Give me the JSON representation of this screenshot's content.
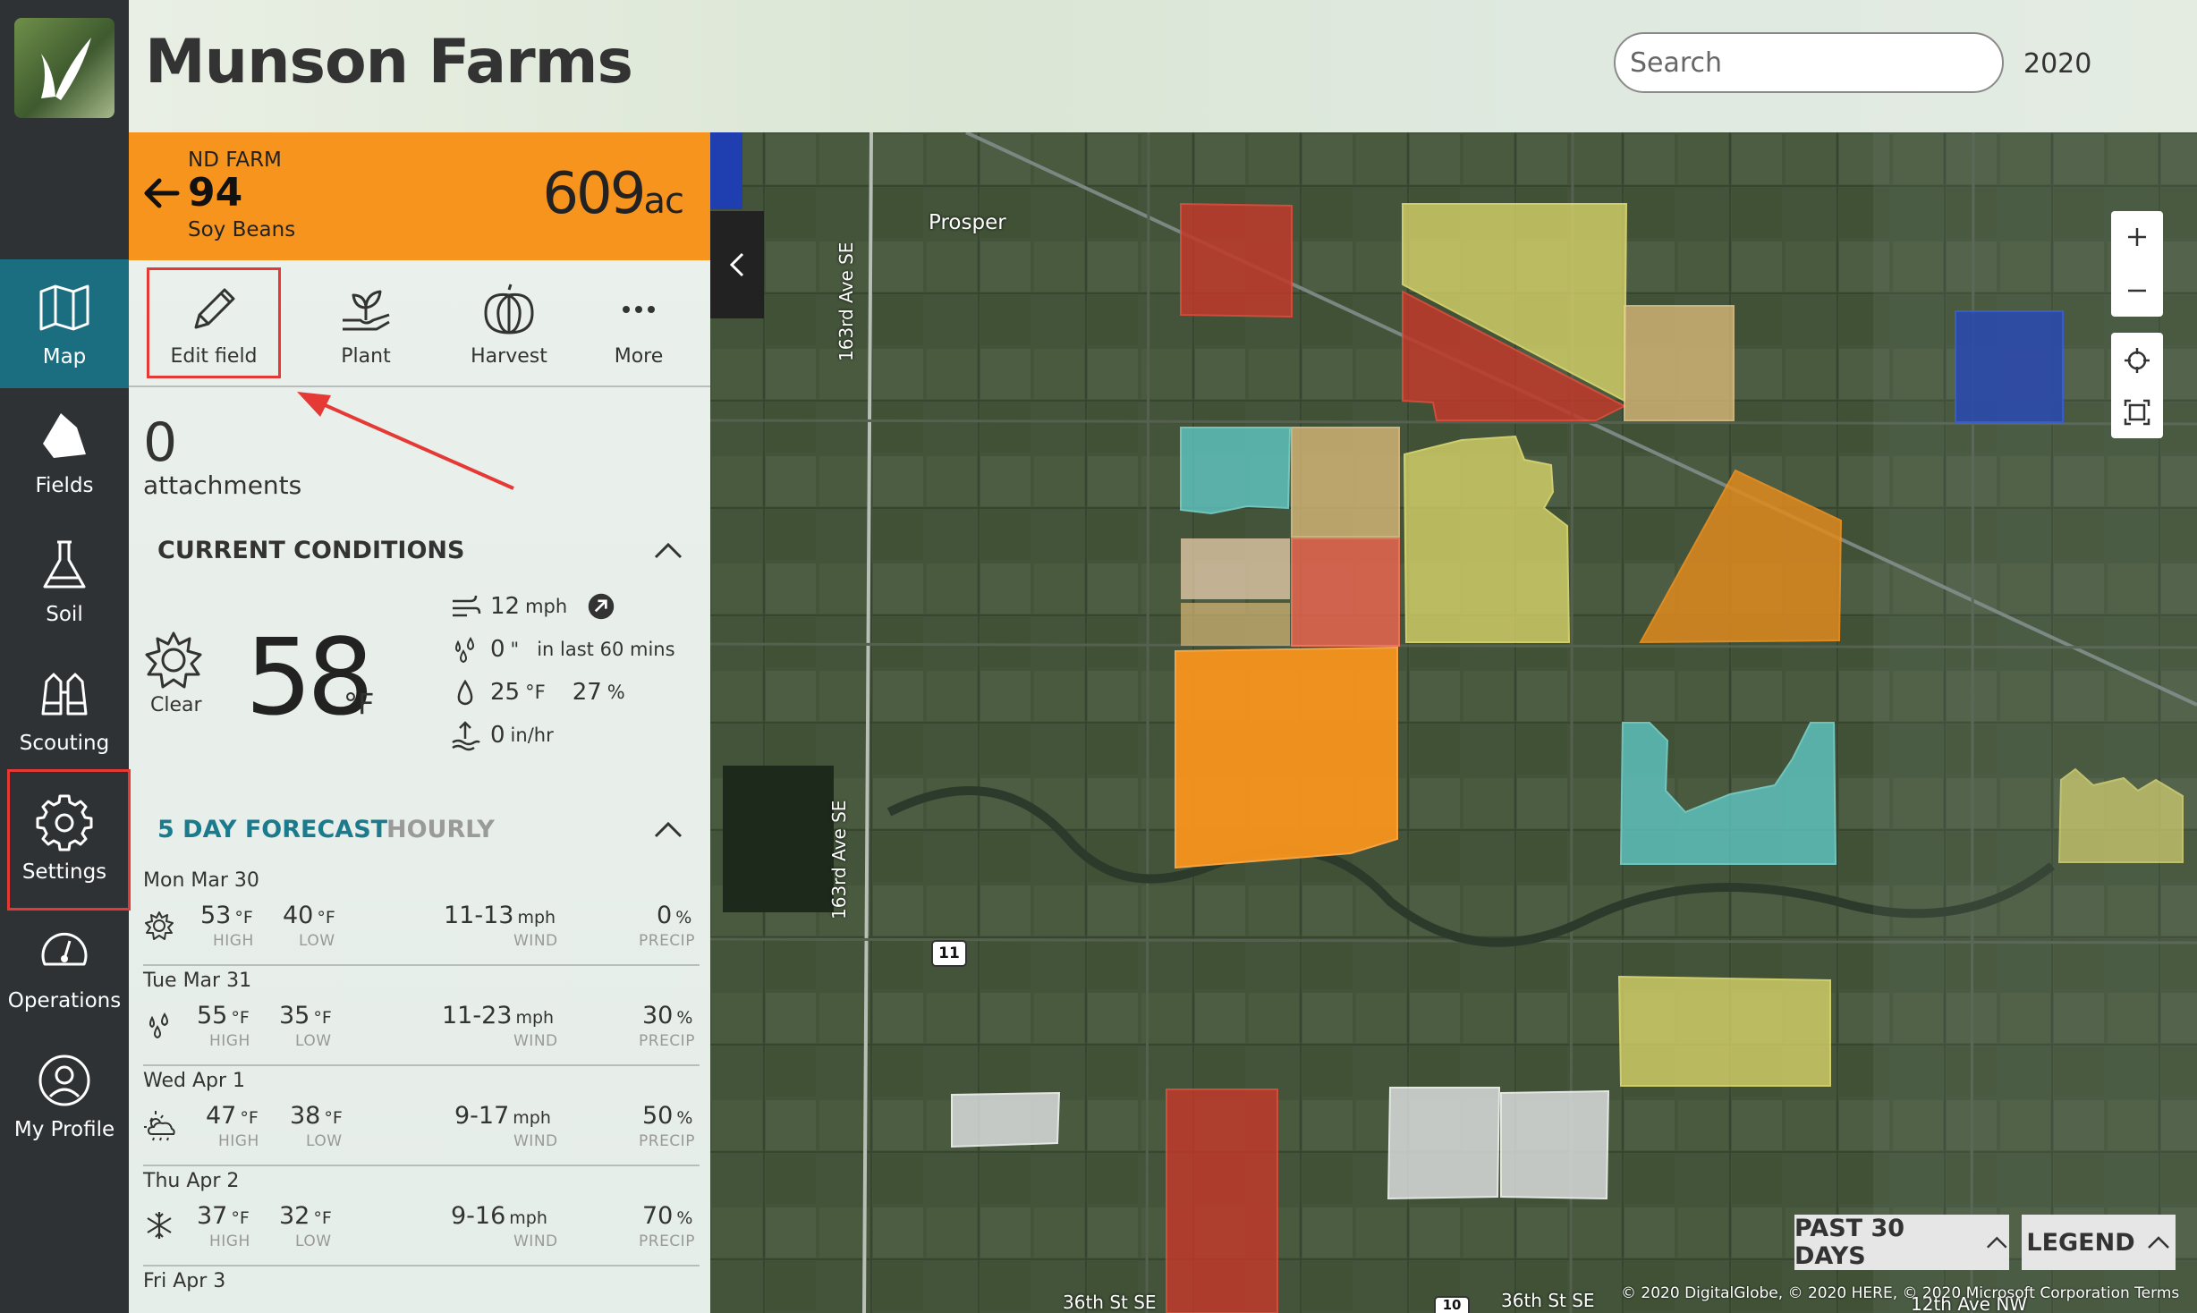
{
  "header": {
    "title": "Munson Farms",
    "search_placeholder": "Search",
    "year": "2020",
    "user_icon": "smiley-icon"
  },
  "nav": {
    "items": [
      {
        "label": "Map",
        "icon": "map-icon",
        "active": true
      },
      {
        "label": "Fields",
        "icon": "fields-icon"
      },
      {
        "label": "Soil",
        "icon": "flask-icon"
      },
      {
        "label": "Scouting",
        "icon": "binoculars-icon"
      },
      {
        "label": "Settings",
        "icon": "gear-icon"
      },
      {
        "label": "Operations",
        "icon": "gauge-icon"
      },
      {
        "label": "My Profile",
        "icon": "user-icon"
      }
    ]
  },
  "field": {
    "farm": "ND FARM",
    "name": "94",
    "crop": "Soy Beans",
    "acres": "609",
    "acres_unit": "ac"
  },
  "actions": [
    {
      "label": "Edit field",
      "icon": "pencil-icon"
    },
    {
      "label": "Plant",
      "icon": "sprout-icon"
    },
    {
      "label": "Harvest",
      "icon": "pumpkin-icon"
    },
    {
      "label": "More",
      "icon": "ellipsis-icon"
    }
  ],
  "attachments": {
    "count": "0",
    "label": "attachments"
  },
  "conditions": {
    "title": "CURRENT CONDITIONS",
    "sky": "Clear",
    "temp": "58",
    "temp_unit": "°F",
    "wind_value": "12",
    "wind_unit": "mph",
    "rain_value": "0",
    "rain_unit": "\"",
    "rain_note": "in last 60 mins",
    "dew_value": "25",
    "dew_unit": "°F",
    "humidity_value": "27",
    "humidity_unit": "%",
    "evap_value": "0",
    "evap_unit": "in/hr"
  },
  "forecast": {
    "title": "5 DAY FORECAST",
    "hourly_tab": "HOURLY",
    "labels": {
      "high": "HIGH",
      "low": "LOW",
      "wind": "WIND",
      "precip": "PRECIP"
    },
    "temp_unit": "°F",
    "wind_unit": "mph",
    "precip_unit": "%",
    "days": [
      {
        "date": "Mon Mar 30",
        "icon": "sun-icon",
        "high": "53",
        "low": "40",
        "wind": "11-13",
        "precip": "0"
      },
      {
        "date": "Tue Mar 31",
        "icon": "rain-drops-icon",
        "high": "55",
        "low": "35",
        "wind": "11-23",
        "precip": "30"
      },
      {
        "date": "Wed Apr 1",
        "icon": "partly-cloudy-icon",
        "high": "47",
        "low": "38",
        "wind": "9-17",
        "precip": "50"
      },
      {
        "date": "Thu Apr 2",
        "icon": "snowflake-icon",
        "high": "37",
        "low": "32",
        "wind": "9-16",
        "precip": "70"
      },
      {
        "date": "Fri Apr 3",
        "icon": "",
        "high": "",
        "low": "",
        "wind": "",
        "precip": ""
      }
    ]
  },
  "map": {
    "labels": {
      "town": "Prosper",
      "road_north": "163rd Ave SE",
      "road_south": "163rd Ave SE",
      "route": "11",
      "route_bottom": "10",
      "street_a": "36th St SE",
      "street_b": "36th St SE",
      "street_c": "12th Ave NW"
    },
    "past_button": "PAST 30 DAYS",
    "legend_button": "LEGEND",
    "attribution": "© 2020 DigitalGlobe, © 2020 HERE, © 2020 Microsoft Corporation  Terms",
    "field_colors": {
      "red": "#c0392b",
      "yellow": "#d7d36a",
      "tan": "#d8b878",
      "cyan": "#5fc7c4",
      "orange": "#f7941d",
      "blue": "#1f3fb0",
      "white": "#d9dcdc",
      "salmon": "#e8654f"
    }
  },
  "theme": {
    "accent": "#1b6e7f",
    "banner": "#f7941d",
    "annotation": "#e53935"
  }
}
